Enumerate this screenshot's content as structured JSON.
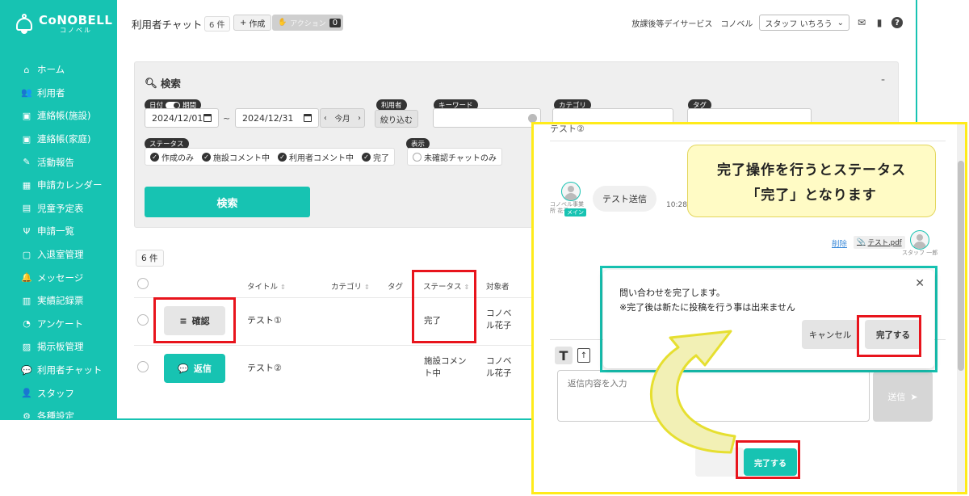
{
  "brand": {
    "name": "CoNOBELL",
    "sub": "コノベル"
  },
  "sidebar": {
    "items": [
      {
        "label": "ホーム",
        "icon": "home-icon",
        "glyph": "⌂"
      },
      {
        "label": "利用者",
        "icon": "users-icon",
        "glyph": "👥"
      },
      {
        "label": "連絡帳(施設)",
        "icon": "contact-book-icon",
        "glyph": "▣"
      },
      {
        "label": "連絡帳(家庭)",
        "icon": "contact-book-icon",
        "glyph": "▣"
      },
      {
        "label": "活動報告",
        "icon": "report-icon",
        "glyph": "✎"
      },
      {
        "label": "申請カレンダー",
        "icon": "calendar-icon",
        "glyph": "▦"
      },
      {
        "label": "児童予定表",
        "icon": "map-icon",
        "glyph": "▤"
      },
      {
        "label": "申請一覧",
        "icon": "list-icon",
        "glyph": "Ψ"
      },
      {
        "label": "入退室管理",
        "icon": "door-icon",
        "glyph": "▢"
      },
      {
        "label": "メッセージ",
        "icon": "bell-icon",
        "glyph": "🔔"
      },
      {
        "label": "実績記録票",
        "icon": "table-icon",
        "glyph": "▥"
      },
      {
        "label": "アンケート",
        "icon": "pie-chart-icon",
        "glyph": "◔"
      },
      {
        "label": "掲示板管理",
        "icon": "board-icon",
        "glyph": "▨"
      },
      {
        "label": "利用者チャット",
        "icon": "chat-icon",
        "glyph": "💬"
      },
      {
        "label": "スタッフ",
        "icon": "staff-icon",
        "glyph": "👤"
      },
      {
        "label": "各種設定",
        "icon": "gear-icon",
        "glyph": "⚙"
      }
    ]
  },
  "header": {
    "title": "利用者チャット",
    "count": "6 件",
    "create_label": "作成",
    "action_label": "アクション",
    "action_count": "0",
    "facility": "放課後等デイサービス　コノベル",
    "staff": "スタッフ いちろう"
  },
  "search": {
    "title": "検索",
    "collapse": "-",
    "date_chip_left": "日付",
    "date_chip_right": "期間",
    "date_from": "2024/12/01",
    "date_to": "2024/12/31",
    "tilde": "~",
    "month_label": "今月",
    "user_chip": "利用者",
    "narrow_label": "絞り込む",
    "keyword_chip": "キーワード",
    "category_chip": "カテゴリ",
    "tag_chip": "タグ",
    "status_chip": "ステータス",
    "status_options": [
      "作成のみ",
      "施設コメント中",
      "利用者コメント中",
      "完了"
    ],
    "display_chip": "表示",
    "display_option": "未確認チャットのみ",
    "search_button": "検索"
  },
  "table": {
    "count": "6 件",
    "headers": {
      "title": "タイトル",
      "category": "カテゴリ",
      "tag": "タグ",
      "status": "ステータス",
      "target": "対象者"
    },
    "rows": [
      {
        "action": "確認",
        "title": "テスト①",
        "status": "完了",
        "target": "コノベル花子"
      },
      {
        "action": "返信",
        "title": "テスト②",
        "status": "施設コメント中",
        "target": "コノベル花子"
      }
    ]
  },
  "zoom": {
    "top_text": "テスト②",
    "sender_name": "コノベル事業所 花子",
    "main_tag": "メイン",
    "message": "テスト送信",
    "time": "10:28",
    "callout_line1": "完了操作を行うとステータス",
    "callout_line2": "「完了」となります",
    "delete_link": "削除",
    "file_name": "テスト.pdf",
    "staff_name": "スタッフ 一郎",
    "dialog_line1": "問い合わせを完了します。",
    "dialog_line2": "※完了後は新たに投稿を行う事は出来ません",
    "dialog_cancel": "キャンセル",
    "dialog_done": "完了する",
    "reply_placeholder": "返信内容を入力",
    "send_label": "送信",
    "done_button": "完了する"
  },
  "colors": {
    "accent": "#17c3b2",
    "highlight_red": "#e8141c",
    "highlight_yellow": "#ffeb1a"
  }
}
